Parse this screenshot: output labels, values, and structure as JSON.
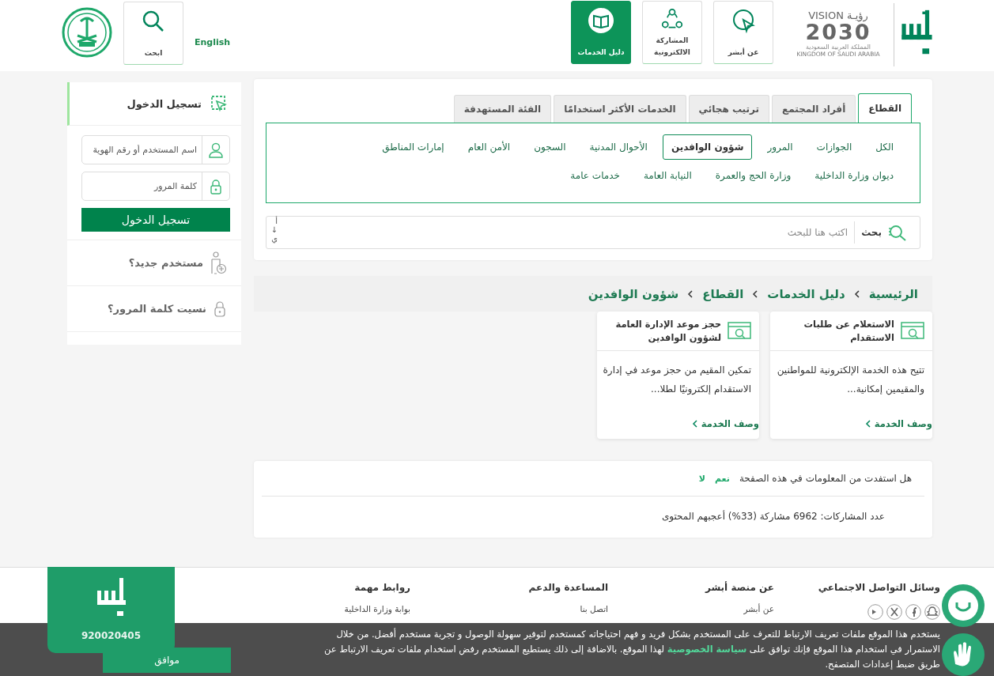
{
  "header": {
    "vision_logo": {
      "word": "VISION",
      "arabic": "رؤيـة",
      "year": "2030",
      "kingdom_ar": "المملكة العربية السعودية",
      "kingdom_en": "KINGDOM OF SAUDI ARABIA"
    },
    "nav": [
      {
        "label": "عن أبشر",
        "kind": "cursor",
        "selected": false
      },
      {
        "label": "المشاركة الالكترونية",
        "kind": "share",
        "selected": false
      },
      {
        "label": "دليل الخدمات",
        "kind": "book",
        "selected": true
      }
    ],
    "language": "English",
    "search": "ابحث"
  },
  "filter": {
    "tabs": [
      {
        "label": "القطاع",
        "selected": true
      },
      {
        "label": "أفراد المجتمع",
        "selected": false
      },
      {
        "label": "ترتيب هجائي",
        "selected": false
      },
      {
        "label": "الخدمات الأكثر استخدامًا",
        "selected": false
      },
      {
        "label": "الفئة المستهدفة",
        "selected": false
      }
    ],
    "sectors": [
      {
        "label": "الكل",
        "selected": false
      },
      {
        "label": "الجوازات",
        "selected": false
      },
      {
        "label": "المرور",
        "selected": false
      },
      {
        "label": "شؤون الوافدين",
        "selected": true
      },
      {
        "label": "الأحوال المدنية",
        "selected": false
      },
      {
        "label": "السجون",
        "selected": false
      },
      {
        "label": "الأمن العام",
        "selected": false
      },
      {
        "label": "إمارات المناطق",
        "selected": false
      },
      {
        "label": "ديوان وزارة الداخلية",
        "selected": false
      },
      {
        "label": "وزارة الحج والعمرة",
        "selected": false
      },
      {
        "label": "النيابة العامة",
        "selected": false
      },
      {
        "label": "خدمات عامة",
        "selected": false
      }
    ],
    "search_label": "بحث",
    "search_placeholder": "اكتب هنا للبحث",
    "sort": "أ↓ي"
  },
  "breadcrumb": [
    "الرئيسية",
    "دليل الخدمات",
    "القطاع",
    "شؤون الوافدين"
  ],
  "services": [
    {
      "title": "الاستعلام عن طلبات الاستقدام",
      "description": "تتيح هذه الخدمة الإلكترونية للمواطنين والمقيمين إمكانية...",
      "link": "وصف الخدمة"
    },
    {
      "title": "حجز موعد الإدارة العامة لشؤون الوافدين",
      "description": "تمكين المقيم من حجز موعد في إدارة الاستقدام إلكترونيًا لطلا...",
      "link": "وصف الخدمة"
    }
  ],
  "feedback": {
    "question": "هل استفدت من المعلومات في هذه الصفحة",
    "yes": "نعم",
    "no": "لا",
    "stats": "عدد المشاركات: 6962 مشاركة (33%) أعجبهم المحتوى"
  },
  "login": {
    "title": "تسجيل الدخول",
    "username_placeholder": "اسم المستخدم أو رقم الهوية",
    "password_placeholder": "كلمة المرور",
    "button": "تسجيل الدخول",
    "new_user": "مستخدم جديد؟",
    "forgot": "نسيت كلمة المرور؟"
  },
  "footer": {
    "social_title": "وسائل التواصل الاجتماعي",
    "columns": [
      {
        "title": "عن منصة أبشر",
        "link": "عن أبشر"
      },
      {
        "title": "المساعدة والدعم",
        "link": "اتصل بنا"
      },
      {
        "title": "روابط مهمة",
        "link": "بوابة وزارة الداخلية"
      }
    ],
    "phone": "920020405"
  },
  "cookie": {
    "text_before": "يستخدم هذا الموقع ملفات تعريف الارتباط للتعرف على المستخدم بشكل فريد و فهم احتياجاته كمستخدم لتوفير سهولة الوصول و تجربة مستخدم أفضل. من خلال الاستمرار في استخدام هذا الموقع فإنك توافق على",
    "link": "سياسة الخصوصية",
    "text_after": "لهذا الموقع. بالاضافة إلى ذلك يستطيع المستخدم رفض استخدام ملفات تعريف الارتباط عن طريق ضبط إعدادات المتصفح.",
    "button": "موافق"
  }
}
